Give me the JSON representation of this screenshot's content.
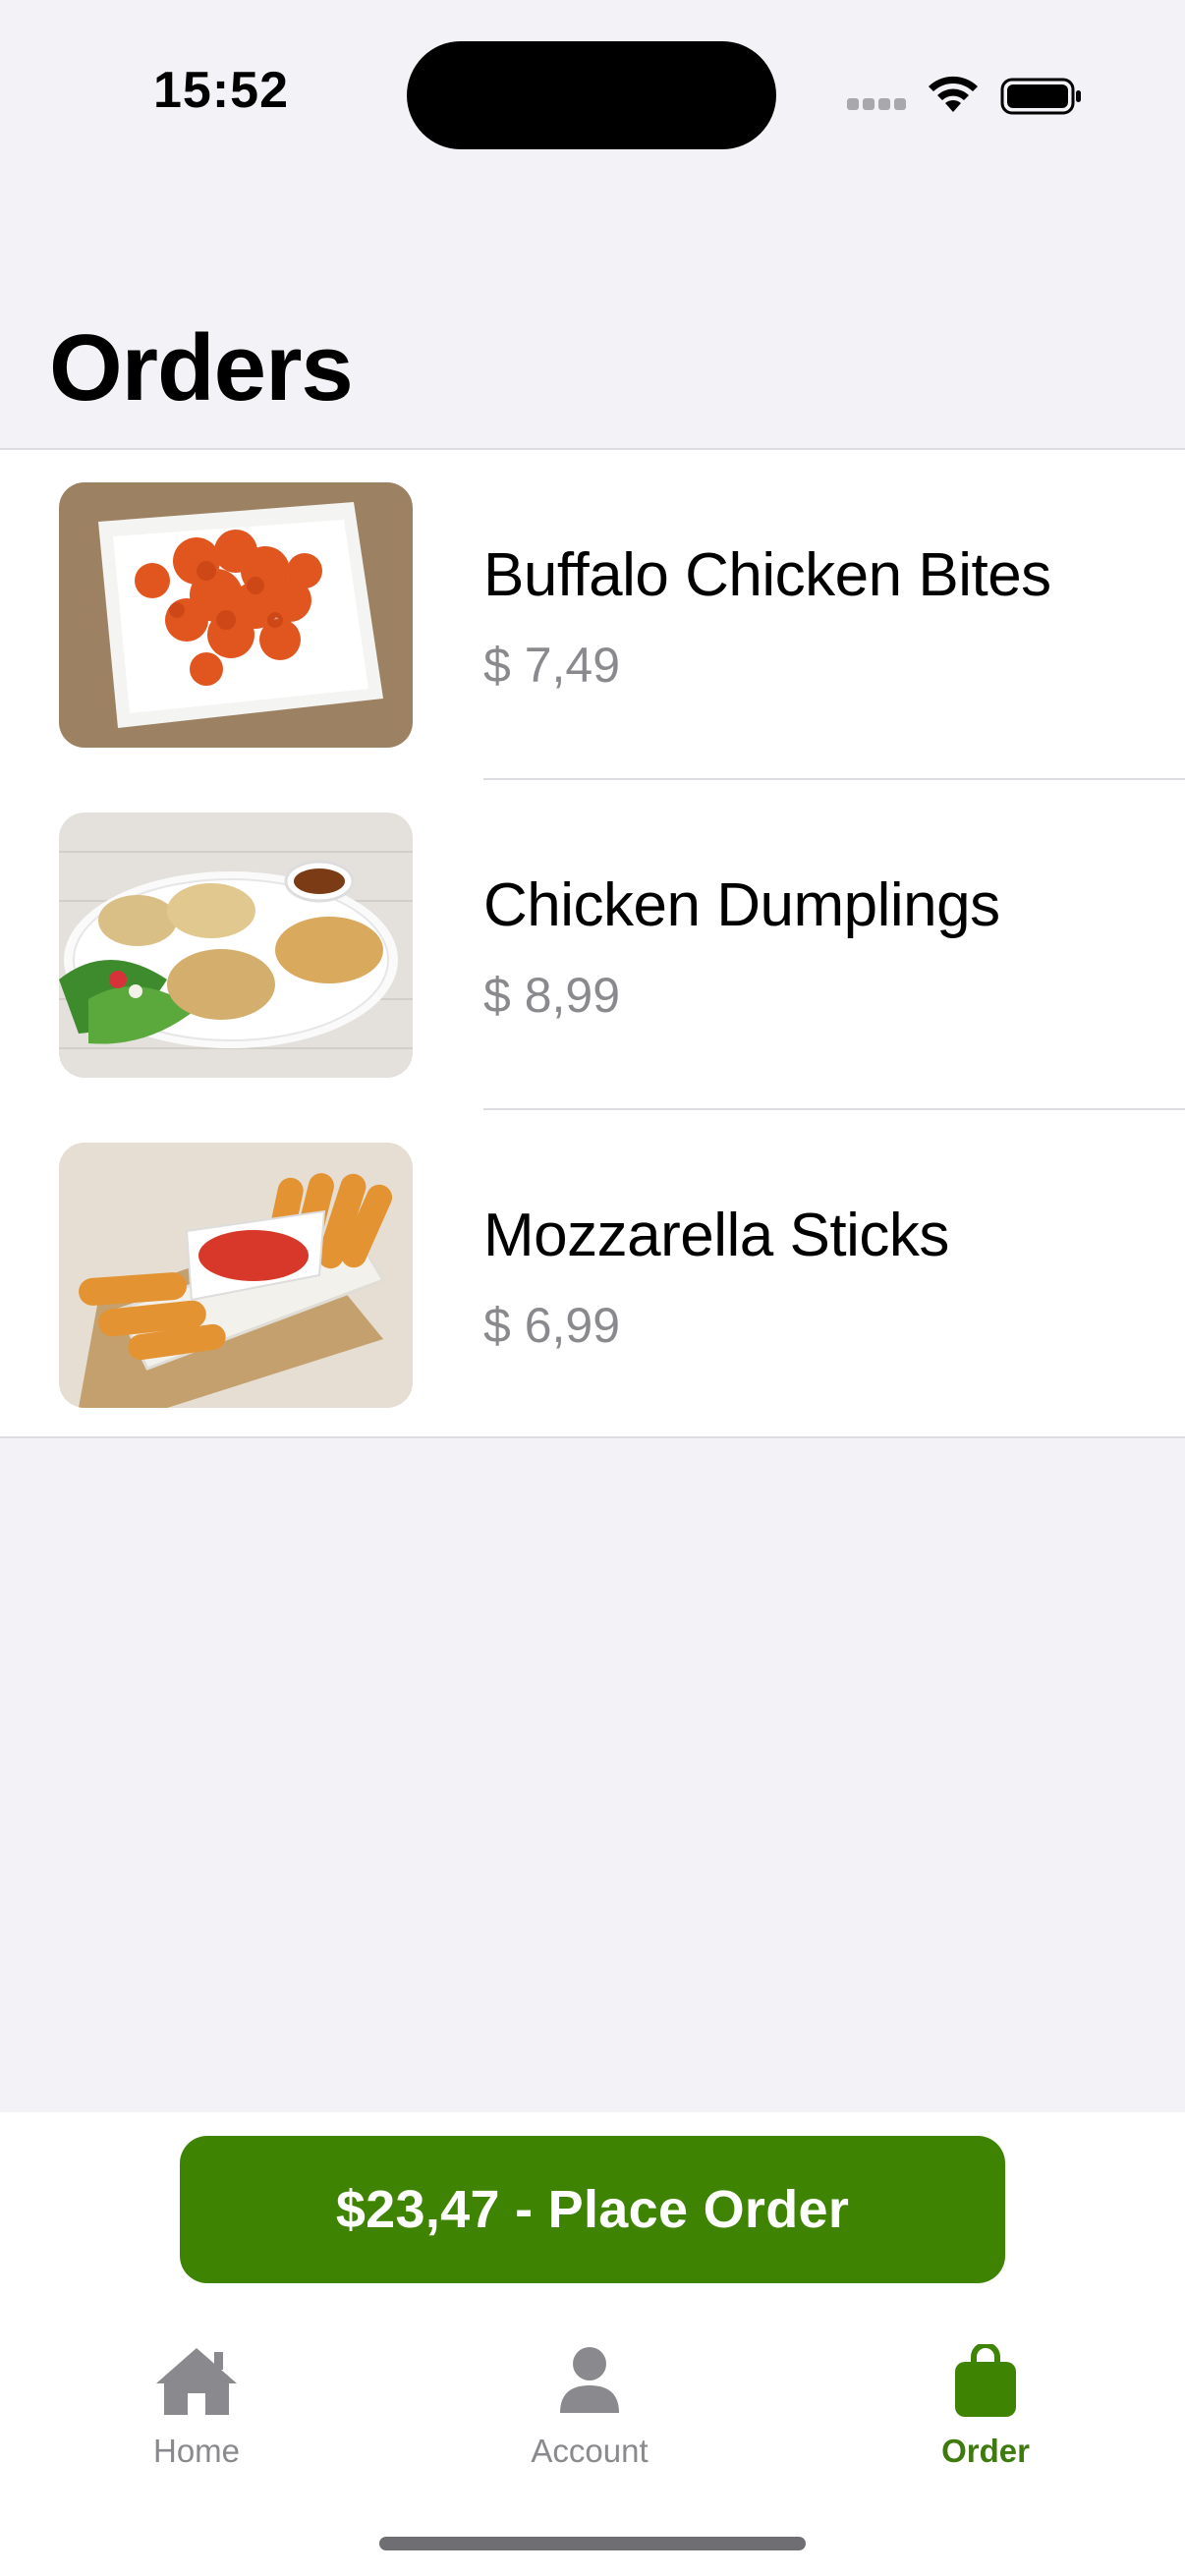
{
  "status_bar": {
    "time": "15:52"
  },
  "page": {
    "title": "Orders"
  },
  "orders": [
    {
      "name": "Buffalo Chicken Bites",
      "price": "$ 7,49"
    },
    {
      "name": "Chicken Dumplings",
      "price": "$ 8,99"
    },
    {
      "name": "Mozzarella Sticks",
      "price": "$ 6,99"
    }
  ],
  "checkout": {
    "button_label": "$23,47 - Place Order",
    "accent_color": "#3E8402"
  },
  "tab_bar": {
    "tabs": [
      {
        "label": "Home",
        "icon": "house-icon",
        "active": false
      },
      {
        "label": "Account",
        "icon": "person-icon",
        "active": false
      },
      {
        "label": "Order",
        "icon": "bag-icon",
        "active": true
      }
    ]
  }
}
